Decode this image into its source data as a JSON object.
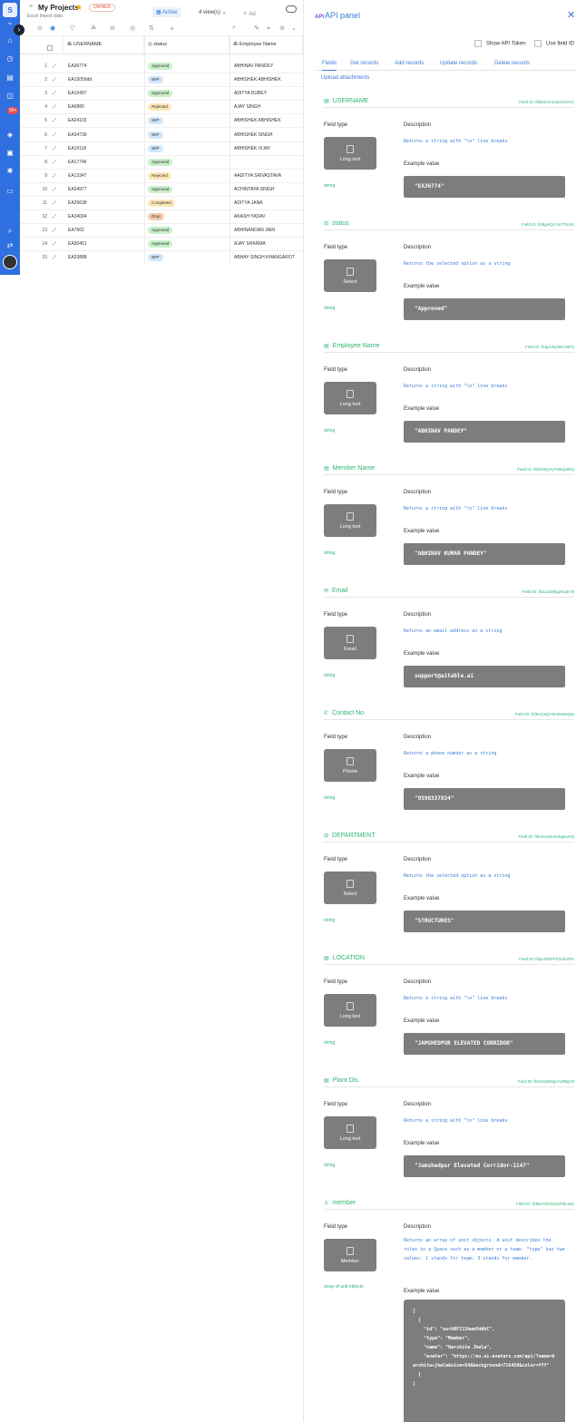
{
  "header": {
    "title": "My Projects",
    "owner_badge": "OWNER",
    "subtitle": "Excel Import data",
    "active_tab": "Active",
    "views": "4 view(s)",
    "add_view": "Ad"
  },
  "rail": {
    "workspace_letter": "S",
    "badge": "99+"
  },
  "grid": {
    "columns": [
      "USERNAME",
      "status",
      "Employee Name"
    ],
    "rows": [
      {
        "n": "1",
        "username": "EA36774",
        "status": "Approved",
        "name": "ABHINAV PANDEY"
      },
      {
        "n": "2",
        "username": "EA15059dd",
        "status": "WIP",
        "name": "ABHISHEK ABHISHEK"
      },
      {
        "n": "3",
        "username": "EA10497",
        "status": "Approved",
        "name": "ADITYA DUBEY"
      },
      {
        "n": "4",
        "username": "EA6880",
        "status": "Rejected",
        "name": "AJAY SINGH"
      },
      {
        "n": "5",
        "username": "EA24103",
        "status": "WIP",
        "name": "ABHISHEK ABHISHEK"
      },
      {
        "n": "6",
        "username": "EA34739",
        "status": "WIP",
        "name": "ABHISHEK SINGH"
      },
      {
        "n": "7",
        "username": "EA10118",
        "status": "WIP",
        "name": "ABHISHEK VIJAY"
      },
      {
        "n": "8",
        "username": "EA17746",
        "status": "Approved",
        "name": ""
      },
      {
        "n": "9",
        "username": "EA13347",
        "status": "Rejected",
        "name": "AADITYA SRIVASTAVA"
      },
      {
        "n": "10",
        "username": "EA34977",
        "status": "Approved",
        "name": "ACHINTAYA SINGH"
      },
      {
        "n": "11",
        "username": "EA25638",
        "status": "Completed",
        "name": "ADITYA JANA"
      },
      {
        "n": "12",
        "username": "EA34004",
        "status": "Drop",
        "name": "AKASH YADAV"
      },
      {
        "n": "13",
        "username": "EA7602",
        "status": "Approved",
        "name": "ABHINANDAN JAIN"
      },
      {
        "n": "14",
        "username": "EA30451",
        "status": "Approved",
        "name": "AJAY SHARMA"
      },
      {
        "n": "15",
        "username": "EA33888",
        "status": "WIP",
        "name": "ABHAY SINGH KHANGAROT"
      }
    ],
    "status_colors": {
      "Approved": "#c9f0c9",
      "WIP": "#cfe6fb",
      "Rejected": "#fde7b8",
      "Completed": "#fde7b8",
      "Drop": "#f8c9b0"
    }
  },
  "panel": {
    "title_badge": "API",
    "title": "API panel",
    "close": "✕",
    "show_token": "Show API Token",
    "use_field_id": "Use field ID",
    "tabs": [
      "Fields",
      "Get records",
      "Add records",
      "Update records",
      "Delete records"
    ],
    "upload": "Upload attachments",
    "labels": {
      "field_type": "Field type",
      "description": "Description",
      "example": "Example value"
    },
    "fields": [
      {
        "name": "USERNAME",
        "id": "Field ID: fldW1XiAmtZvzKGvC",
        "type": "Long text",
        "desc": "Returns a string with \"\\n\" line breaks",
        "dtype": "string",
        "example": "\"EA36774\""
      },
      {
        "name": "status",
        "id": "Field ID: fld6gHQcYucTOcsX",
        "type": "Select",
        "desc": "Returns the selected option as a string",
        "dtype": "string",
        "example": "\"Approved\""
      },
      {
        "name": "Employee Name",
        "id": "Field ID: fldqJcky66KoN07j",
        "type": "Long text",
        "desc": "Returns a string with \"\\n\" line breaks",
        "dtype": "string",
        "example": "\"ABHINAV PANDEY\""
      },
      {
        "name": "Member Name",
        "id": "Field ID: fldS49QmyTMBqz9Rq",
        "type": "Long text",
        "desc": "Returns a string with \"\\n\" line breaks",
        "dtype": "string",
        "example": "\"ABHINAV KUMAR PANDEY\""
      },
      {
        "name": "Email",
        "id": "Field ID: fldx1ZM4lgZKujK78",
        "type": "Email",
        "desc": "Returns an email address as a string",
        "dtype": "string",
        "example": "support@aitable.ai"
      },
      {
        "name": "Contact No.",
        "id": "Field ID: fld6oCwQY5m9wMQ9a",
        "type": "Phone",
        "desc": "Returns a phone number as a string",
        "dtype": "string",
        "example": "\"9598337834\""
      },
      {
        "name": "DEPARTMENT",
        "id": "Field ID: fldomezEmGBgEuKQ",
        "type": "Select",
        "desc": "Returns the selected option as a string",
        "dtype": "string",
        "example": "\"STRUCTURES\""
      },
      {
        "name": "LOCATION",
        "id": "Field ID: fldyo29nFFR2mk2PK",
        "type": "Long text",
        "desc": "Returns a string with \"\\n\" line breaks",
        "dtype": "string",
        "example": "\"JAMSHEDPUR ELEVATED  CORRIDOR\""
      },
      {
        "name": "Plant Dis.",
        "id": "Field ID: fldV1Qkh9gnAWBgV8",
        "type": "Long text",
        "desc": "Returns a string with \"\\n\" line breaks",
        "dtype": "string",
        "example": "\"Jamshedpur Elevated Corridor-1147\""
      }
    ],
    "member": {
      "name": "member",
      "id": "Field ID: fldMs78tYDSQFMc18u",
      "type": "Member",
      "desc": "Returns an array of unit objects. A unit describes the roles in a Space such as a member or a team. \"type\" has two values: 1 stands for team; 3 stands for member.",
      "dtype": "array of unit objects",
      "example": "[\n  {\n    \"id\": \"usrhBFI15hwmXnWhC\",\n    \"type\": \"Member\",\n    \"name\": \"Harshita Jhala\",\n    \"avatar\": \"https://eu.ui-avatars.com/api/?name=harshita+jhala&size=64&background=716450&color=fff\"\n  }\n]"
    }
  }
}
